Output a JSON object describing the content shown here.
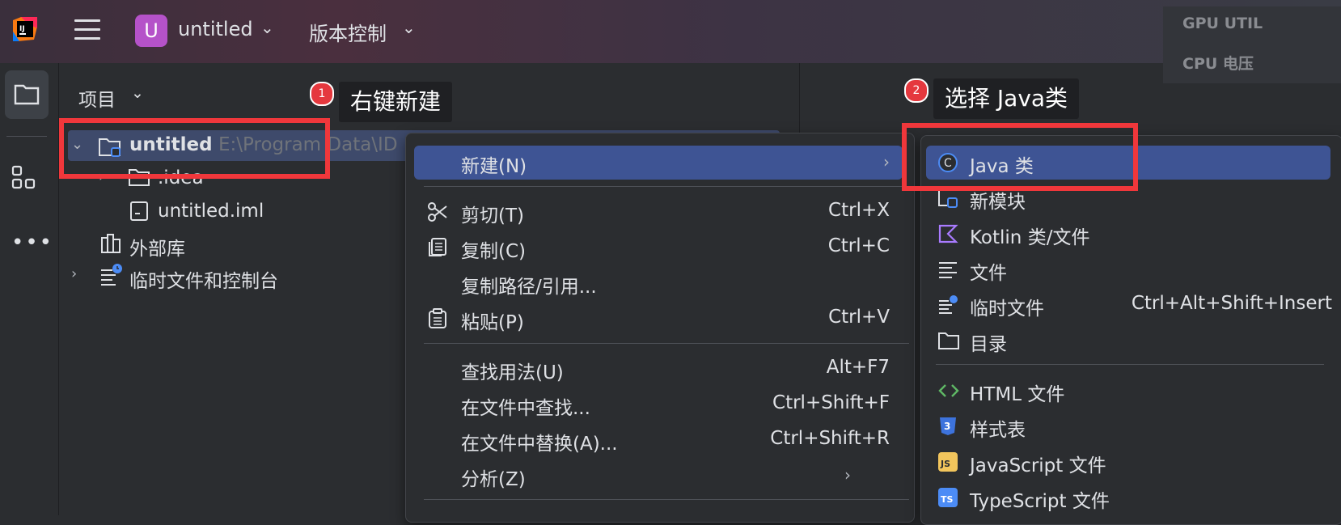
{
  "titlebar": {
    "project_initial": "U",
    "project_name": "untitled",
    "vcs_label": "版本控制"
  },
  "overlay": {
    "line1": "GPU UTIL",
    "line2": "CPU 电压"
  },
  "project_panel": {
    "title": "项目",
    "tree": {
      "root_name": "untitled",
      "root_path": "E:\\Program Data\\ID",
      "items": [
        ".idea",
        "untitled.iml",
        "外部库",
        "临时文件和控制台"
      ]
    }
  },
  "annotations": {
    "step1_number": "1",
    "step1_text": "右键新建",
    "step2_number": "2",
    "step2_text": "选择 Java类"
  },
  "context_menu": {
    "new_label": "新建(N)",
    "cut_label": "剪切(T)",
    "cut_shortcut": "Ctrl+X",
    "copy_label": "复制(C)",
    "copy_shortcut": "Ctrl+C",
    "copy_path_label": "复制路径/引用...",
    "paste_label": "粘贴(P)",
    "paste_shortcut": "Ctrl+V",
    "find_usages_label": "查找用法(U)",
    "find_usages_shortcut": "Alt+F7",
    "find_in_files_label": "在文件中查找...",
    "find_in_files_shortcut": "Ctrl+Shift+F",
    "replace_in_files_label": "在文件中替换(A)...",
    "replace_in_files_shortcut": "Ctrl+Shift+R",
    "analyze_label": "分析(Z)"
  },
  "new_submenu": {
    "java_class": "Java 类",
    "new_module": "新模块",
    "kotlin": "Kotlin 类/文件",
    "file": "文件",
    "scratch": "临时文件",
    "scratch_shortcut": "Ctrl+Alt+Shift+Insert",
    "directory": "目录",
    "html": "HTML 文件",
    "stylesheet": "样式表",
    "javascript": "JavaScript 文件",
    "typescript": "TypeScript 文件"
  },
  "colors": {
    "accent_highlight": "#3e5494",
    "annotation_red": "#f0373b",
    "project_avatar": "#b552c9"
  }
}
